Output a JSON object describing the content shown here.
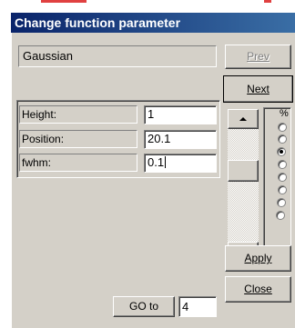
{
  "window": {
    "title": "Change function parameter"
  },
  "function": {
    "name": "Gaussian"
  },
  "buttons": {
    "prev": "Prev",
    "next": "Next",
    "apply": "Apply",
    "close": "Close",
    "goto": "GO to"
  },
  "parameters": [
    {
      "label": "Height:",
      "value": "1"
    },
    {
      "label": "Position:",
      "value": "20.1"
    },
    {
      "label": "fwhm:",
      "value": "0.1"
    }
  ],
  "step_group": {
    "label": "%",
    "options_count": 6,
    "selected_index": 2
  },
  "goto": {
    "value": "4"
  },
  "colors": {
    "titlebar_start": "#0a246a",
    "titlebar_end": "#3a6ea5",
    "face": "#d4d0c8"
  }
}
